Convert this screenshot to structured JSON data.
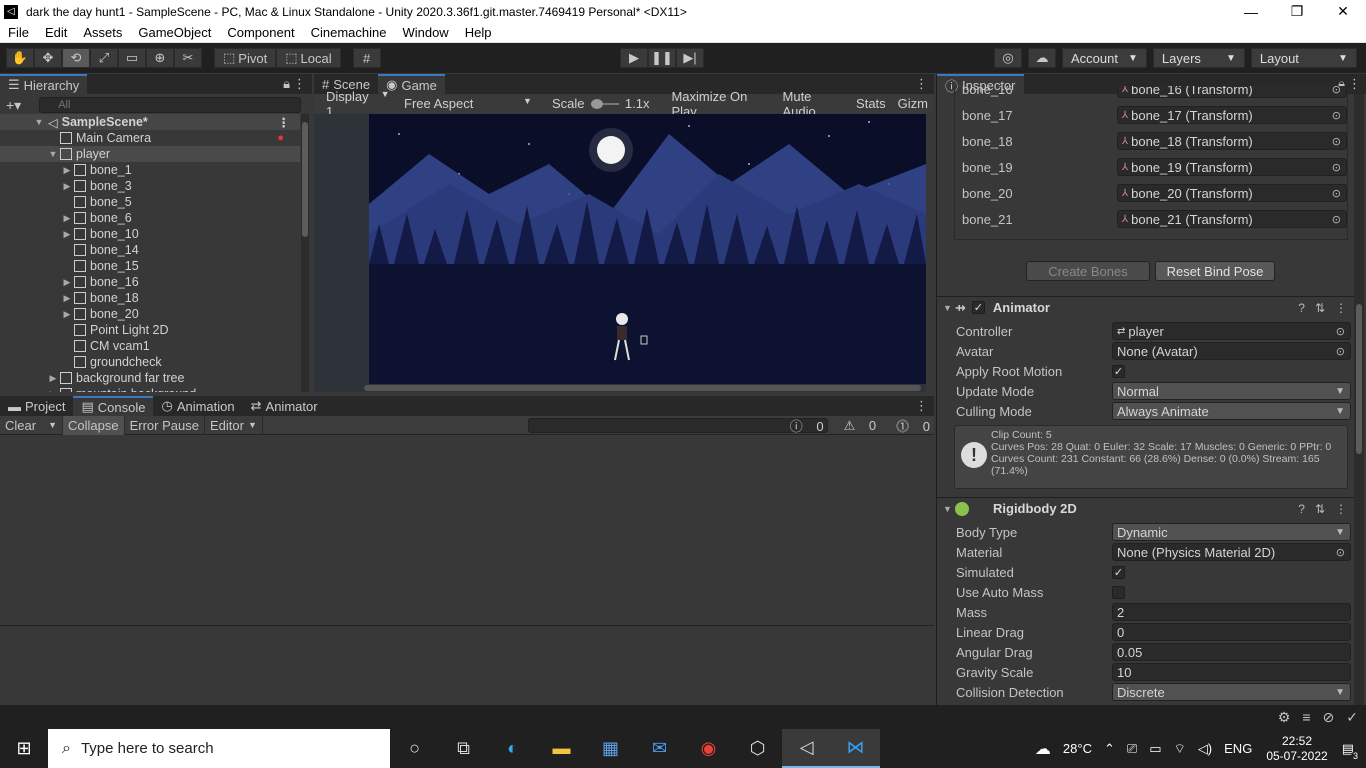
{
  "window": {
    "title": "dark the day hunt1 - SampleScene - PC, Mac & Linux Standalone - Unity 2020.3.36f1.git.master.7469419 Personal* <DX11>",
    "minimize": "—",
    "maximize": "❐",
    "close": "✕"
  },
  "menu": [
    "File",
    "Edit",
    "Assets",
    "GameObject",
    "Component",
    "Cinemachine",
    "Window",
    "Help"
  ],
  "toolbar": {
    "pivot": "Pivot",
    "local": "Local",
    "account": "Account",
    "layers": "Layers",
    "layout": "Layout"
  },
  "hierarchy": {
    "tab": "Hierarchy",
    "search_placeholder": "All",
    "scene": "SampleScene*",
    "items": [
      {
        "label": "Main Camera",
        "indent": 1,
        "arrow": ""
      },
      {
        "label": "player",
        "indent": 1,
        "arrow": "▼"
      },
      {
        "label": "bone_1",
        "indent": 2,
        "arrow": "▶"
      },
      {
        "label": "bone_3",
        "indent": 2,
        "arrow": "▶"
      },
      {
        "label": "bone_5",
        "indent": 2,
        "arrow": ""
      },
      {
        "label": "bone_6",
        "indent": 2,
        "arrow": "▶"
      },
      {
        "label": "bone_10",
        "indent": 2,
        "arrow": "▶"
      },
      {
        "label": "bone_14",
        "indent": 2,
        "arrow": ""
      },
      {
        "label": "bone_15",
        "indent": 2,
        "arrow": ""
      },
      {
        "label": "bone_16",
        "indent": 2,
        "arrow": "▶"
      },
      {
        "label": "bone_18",
        "indent": 2,
        "arrow": "▶"
      },
      {
        "label": "bone_20",
        "indent": 2,
        "arrow": "▶"
      },
      {
        "label": "Point Light 2D",
        "indent": 2,
        "arrow": ""
      },
      {
        "label": "CM vcam1",
        "indent": 2,
        "arrow": ""
      },
      {
        "label": "groundcheck",
        "indent": 2,
        "arrow": ""
      },
      {
        "label": "background far tree",
        "indent": 1,
        "arrow": "▶"
      },
      {
        "label": "mountain background",
        "indent": 1,
        "arrow": "▶"
      }
    ]
  },
  "game": {
    "tab_scene": "Scene",
    "tab_game": "Game",
    "display": "Display 1",
    "aspect": "Free Aspect",
    "scale_label": "Scale",
    "scale_value": "1.1x",
    "maximize": "Maximize On Play",
    "mute": "Mute Audio",
    "stats": "Stats",
    "gizmos": "Gizm"
  },
  "console": {
    "tabs": [
      "Project",
      "Console",
      "Animation",
      "Animator"
    ],
    "clear": "Clear",
    "collapse": "Collapse",
    "error_pause": "Error Pause",
    "editor": "Editor",
    "count_info": "0",
    "count_warn": "0",
    "count_error": "0"
  },
  "inspector": {
    "tab": "Inspector",
    "bones": [
      {
        "name": "bone_16",
        "value": "bone_16 (Transform)"
      },
      {
        "name": "bone_17",
        "value": "bone_17 (Transform)"
      },
      {
        "name": "bone_18",
        "value": "bone_18 (Transform)"
      },
      {
        "name": "bone_19",
        "value": "bone_19 (Transform)"
      },
      {
        "name": "bone_20",
        "value": "bone_20 (Transform)"
      },
      {
        "name": "bone_21",
        "value": "bone_21 (Transform)"
      }
    ],
    "create_bones": "Create Bones",
    "reset_bind_pose": "Reset Bind Pose",
    "animator": {
      "title": "Animator",
      "controller_label": "Controller",
      "controller_value": "player",
      "avatar_label": "Avatar",
      "avatar_value": "None (Avatar)",
      "root_motion_label": "Apply Root Motion",
      "update_mode_label": "Update Mode",
      "update_mode_value": "Normal",
      "culling_mode_label": "Culling Mode",
      "culling_mode_value": "Always Animate",
      "info_line1": "Clip Count: 5",
      "info_line2": "Curves Pos: 28 Quat: 0 Euler: 32 Scale: 17 Muscles: 0 Generic: 0 PPtr: 0",
      "info_line3": "Curves Count: 231 Constant: 66 (28.6%) Dense: 0 (0.0%) Stream: 165",
      "info_line4": "(71.4%)"
    },
    "rigidbody": {
      "title": "Rigidbody 2D",
      "body_type_label": "Body Type",
      "body_type_value": "Dynamic",
      "material_label": "Material",
      "material_value": "None (Physics Material 2D)",
      "simulated_label": "Simulated",
      "auto_mass_label": "Use Auto Mass",
      "mass_label": "Mass",
      "mass_value": "2",
      "linear_drag_label": "Linear Drag",
      "linear_drag_value": "0",
      "angular_drag_label": "Angular Drag",
      "angular_drag_value": "0.05",
      "gravity_label": "Gravity Scale",
      "gravity_value": "10",
      "collision_label": "Collision Detection",
      "collision_value": "Discrete"
    }
  },
  "taskbar": {
    "search_placeholder": "Type here to search",
    "weather": "28°C",
    "lang": "ENG",
    "time": "22:52",
    "date": "05-07-2022",
    "notif_count": "3"
  }
}
